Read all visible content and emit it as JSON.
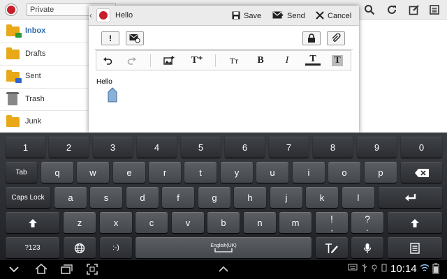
{
  "background_app": {
    "account": "Private",
    "folders": [
      {
        "label": "Inbox",
        "icon": "inbox-folder-icon",
        "active": true
      },
      {
        "label": "Drafts",
        "icon": "drafts-folder-icon",
        "active": false
      },
      {
        "label": "Sent",
        "icon": "sent-folder-icon",
        "active": false
      },
      {
        "label": "Trash",
        "icon": "trash-folder-icon",
        "active": false
      },
      {
        "label": "Junk",
        "icon": "junk-folder-icon",
        "active": false
      }
    ],
    "actions": [
      "search-icon",
      "refresh-icon",
      "compose-icon",
      "menu-icon"
    ]
  },
  "compose": {
    "title": "Hello",
    "save_label": "Save",
    "send_label": "Send",
    "cancel_label": "Cancel",
    "priority_label": "!",
    "body": "Hello",
    "format_buttons": {
      "text_size": "Tт",
      "bold": "B",
      "italic": "I",
      "font_color": "T",
      "highlight": "T",
      "insert_text": "T⁺"
    }
  },
  "keyboard": {
    "row1": [
      "1",
      "2",
      "3",
      "4",
      "5",
      "6",
      "7",
      "8",
      "9",
      "0"
    ],
    "tab": "Tab",
    "row2": [
      "q",
      "w",
      "e",
      "r",
      "t",
      "y",
      "u",
      "i",
      "o",
      "p"
    ],
    "caps": "Caps Lock",
    "row3": [
      "a",
      "s",
      "d",
      "f",
      "g",
      "h",
      "j",
      "k",
      "l"
    ],
    "row4": [
      "z",
      "x",
      "c",
      "v",
      "b",
      "n",
      "m",
      "!",
      "?"
    ],
    "row4_alt": [
      ",",
      "."
    ],
    "sym": "?123",
    "smiley": ":-)",
    "space_label": "English(UK)"
  },
  "status": {
    "time": "10:14"
  },
  "colors": {
    "brand_red": "#c8202a",
    "folder_yellow": "#e8a817",
    "active_folder": "#2a6aa8",
    "keyboard_bg": "#2a2c30"
  }
}
